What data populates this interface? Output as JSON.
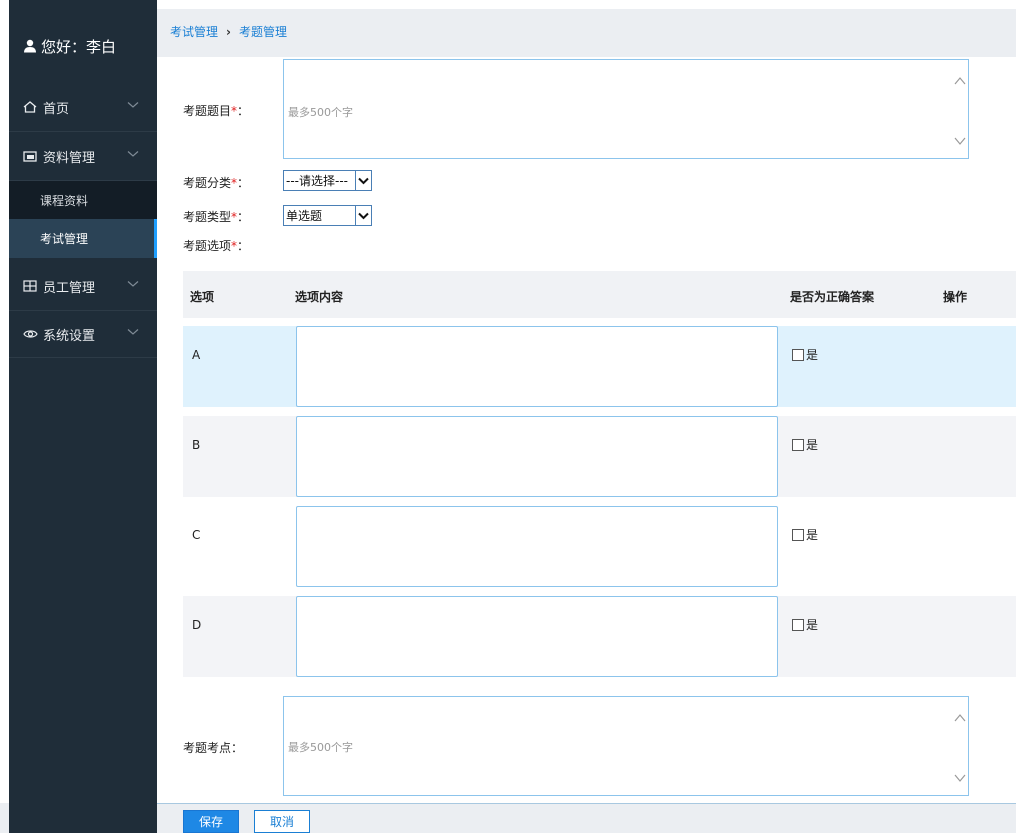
{
  "user": {
    "greeting": "您好：李白",
    "icon": "user-icon"
  },
  "sidebar": {
    "items": [
      {
        "label": "首页",
        "icon": "home-icon"
      },
      {
        "label": "资料管理",
        "icon": "folder-icon"
      },
      {
        "label": "员工管理",
        "icon": "employee-icon"
      },
      {
        "label": "系统设置",
        "icon": "eye-settings-icon"
      }
    ],
    "sub_items": [
      {
        "label": "课程资料"
      },
      {
        "label": "考试管理"
      }
    ]
  },
  "breadcrumb": {
    "parent": "考试管理",
    "separator": "›",
    "current": "考题管理"
  },
  "form": {
    "title_label": "考题题目",
    "title_placeholder": "最多500个字",
    "category_label": "考题分类",
    "category_value": "---请选择---",
    "type_label": "考题类型",
    "type_value": "单选题",
    "options_label": "考题选项",
    "required_mark": "*",
    "colon": "：",
    "point_label": "考题考点：",
    "point_placeholder": "最多500个字"
  },
  "options_table": {
    "headers": {
      "option": "选项",
      "content": "选项内容",
      "correct": "是否为正确答案",
      "action": "操作"
    },
    "rows": [
      {
        "letter": "A",
        "correct_label": "是"
      },
      {
        "letter": "B",
        "correct_label": "是"
      },
      {
        "letter": "C",
        "correct_label": "是"
      },
      {
        "letter": "D",
        "correct_label": "是"
      }
    ]
  },
  "actions": {
    "save": "保存",
    "cancel": "取消"
  },
  "colors": {
    "sidebar_bg": "#1f2d39",
    "accent": "#1e88e5",
    "active_row": "#dff2fd",
    "alt_row": "#f3f4f7"
  }
}
